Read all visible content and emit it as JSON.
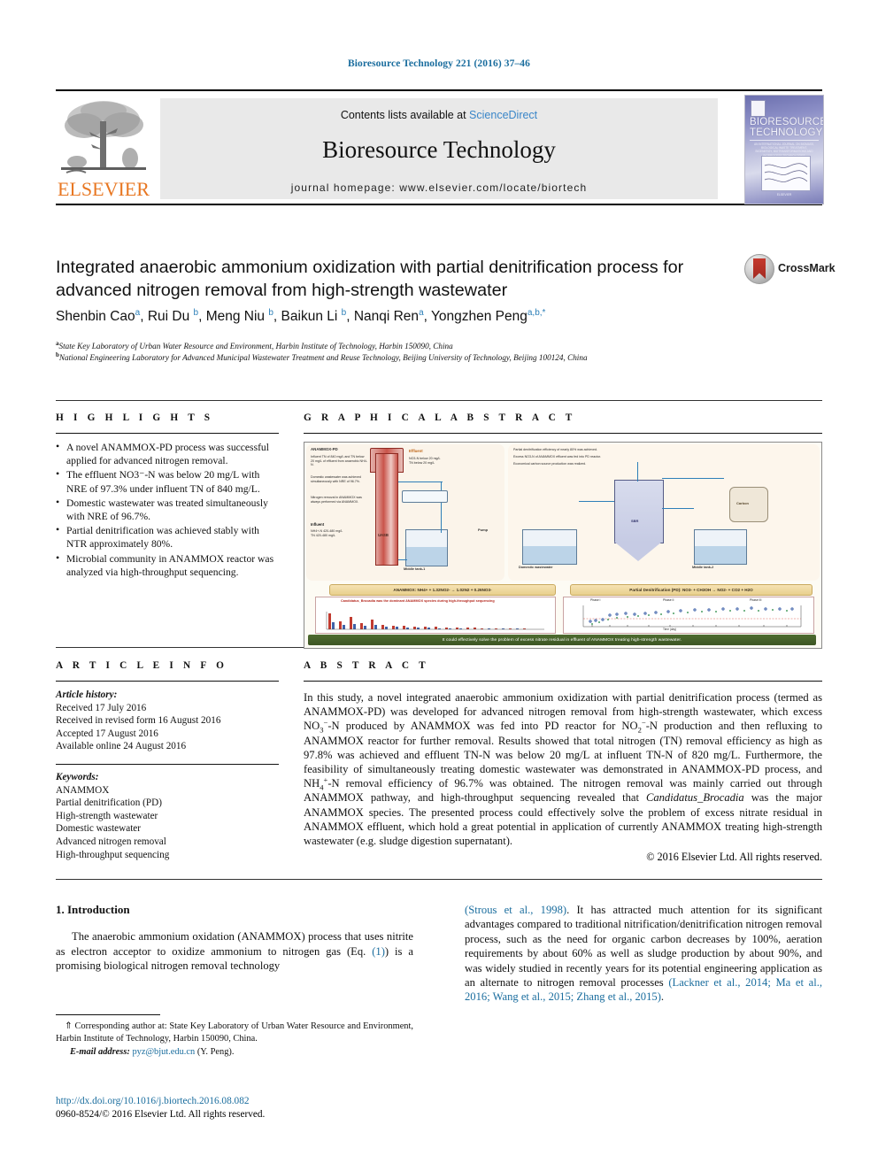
{
  "running_head": "Bioresource Technology 221 (2016) 37–46",
  "masthead": {
    "publisher_name": "ELSEVIER",
    "contents_prefix": "Contents lists available at ",
    "contents_link": "ScienceDirect",
    "journal_name": "Bioresource Technology",
    "homepage": "journal homepage: www.elsevier.com/locate/biortech",
    "cover": {
      "title_line1": "BIORESOURCE",
      "title_line2": "TECHNOLOGY",
      "subtitle": "AN INTERNATIONAL JOURNAL ON BIOMASS, BIOLOGICAL WASTE TREATMENT, BIOENERGY, BIOTRANSFORMATIONS AND BIOPROCESS TECHNOLOGIES",
      "footer": "ELSEVIER"
    }
  },
  "article": {
    "title": "Integrated anaerobic ammonium oxidization with partial denitrification process for advanced nitrogen removal from high-strength wastewater",
    "crossmark_label": "CrossMark",
    "authors": [
      {
        "name": "Shenbin Cao",
        "sup": "a"
      },
      {
        "name": "Rui Du",
        "sup": "b"
      },
      {
        "name": "Meng Niu",
        "sup": "b"
      },
      {
        "name": "Baikun Li",
        "sup": "b"
      },
      {
        "name": "Nanqi Ren",
        "sup": "a"
      },
      {
        "name": "Yongzhen Peng",
        "sup": "a,b,*"
      }
    ],
    "affiliations": [
      {
        "mark": "a",
        "text": "State Key Laboratory of Urban Water Resource and Environment, Harbin Institute of Technology, Harbin 150090, China"
      },
      {
        "mark": "b",
        "text": "National Engineering Laboratory for Advanced Municipal Wastewater Treatment and Reuse Technology, Beijing University of Technology, Beijing 100124, China"
      }
    ]
  },
  "highlights": {
    "heading": "H I G H L I G H T S",
    "items": [
      "A novel ANAMMOX-PD process was successful applied for advanced nitrogen removal.",
      "The effluent NO3⁻-N was below 20 mg/L with NRE of 97.3% under influent TN of 840 mg/L.",
      "Domestic wastewater was treated simultaneously with NRE of 96.7%.",
      "Partial denitrification was achieved stably with NTR approximately 80%.",
      "Microbial community in ANAMMOX reactor was analyzed via high-throughput sequencing."
    ]
  },
  "graphical_abstract": {
    "heading": "G R A P H I C A L   A B S T R A C T",
    "figure": {
      "left_panel_title": "ANAMMOX-PD",
      "left_panel_bullets": [
        "Influent TN of 840 mg/L and TN below 20 mg/L of effluent from anaerobic NH4-N.",
        "Domestic wastewater was achieved simultaneously with NRE of 96.7%.",
        "Nitrogen removal in ANAMMOX was always performed via ANAMMOX."
      ],
      "influent_label": "Influent",
      "influent_values": "NH4+-N 420-480 mg/L\nTN 420-480 mg/L",
      "uasb_label": "UASB",
      "effluent_label": "Effluent",
      "effluent_note": "NO3-N below 20 mg/L\nTN below 20 mg/L",
      "tank1_label": "Middle tank-1",
      "tank2_label": "Middle tank-2",
      "sbr_label": "SBR",
      "pump_label": "Pump",
      "carbon_label": "Carbon",
      "domestic_label": "Domestic wastewater",
      "right_panel_bullets": [
        "Partial denitrification efficiency of nearly 80% was achieved.",
        "Excess NO3-N of ANAMMOX effluent was fed into PD reactor.",
        "Economical carbon source production was realized."
      ],
      "anammox_equation": "ANAMMOX: NH4+ + 1.32NO2- → 1.02N2 + 0.26NO3-",
      "pd_equation": "Partial Denitrification (PD): NO3- + CH3OH → NO2- + CO2 + H2O",
      "chart_left_title": "Candidatus_Brocadia was the dominant ANAMMOX species during high-throughput sequencing",
      "chart_right_phases": [
        "Phase I",
        "Phase II",
        "Phase III"
      ],
      "chart_right_legend": [
        "TN INF",
        "TN EFF",
        "TN removal efficiency"
      ],
      "chart_right_xlabel": "Time (day)",
      "chart_right_ylabel": "TN (mg/L)",
      "chart_right_y2label": "TN removal efficiency (%)",
      "banner": "It could effectively solve the problem of excess nitrate residual in effluent of ANAMMOX treating high-strength wastewater."
    }
  },
  "article_info": {
    "heading": "A R T I C L E   I N F O",
    "history_label": "Article history:",
    "history": [
      "Received 17 July 2016",
      "Received in revised form 16 August 2016",
      "Accepted 17 August 2016",
      "Available online 24 August 2016"
    ],
    "keywords_label": "Keywords:",
    "keywords": [
      "ANAMMOX",
      "Partial denitrification (PD)",
      "High-strength wastewater",
      "Domestic wastewater",
      "Advanced nitrogen removal",
      "High-throughput sequencing"
    ]
  },
  "abstract": {
    "heading": "A B S T R A C T",
    "text_part1": "In this study, a novel integrated anaerobic ammonium oxidization with partial denitrification process (termed as ANAMMOX-PD) was developed for advanced nitrogen removal from high-strength wastewater, which excess NO",
    "text_part2": "-N produced by ANAMMOX was fed into PD reactor for NO",
    "text_part3": "-N production and then refluxing to ANAMMOX reactor for further removal. Results showed that total nitrogen (TN) removal efficiency as high as 97.8% was achieved and effluent TN-N was below 20 mg/L at influent TN-N of 820 mg/L. Furthermore, the feasibility of simultaneously treating domestic wastewater was demonstrated in ANAMMOX-PD process, and NH",
    "text_part4": "-N removal efficiency of 96.7% was obtained. The nitrogen removal was mainly carried out through ANAMMOX pathway, and high-throughput sequencing revealed that ",
    "species": "Candidatus_Brocadia",
    "text_part5": " was the major ANAMMOX species. The presented process could effectively solve the problem of excess nitrate residual in ANAMMOX effluent, which hold a great potential in application of currently ANAMMOX treating high-strength wastewater (e.g. sludge digestion supernatant).",
    "copyright": "© 2016 Elsevier Ltd. All rights reserved."
  },
  "introduction": {
    "section_number_title": "1. Introduction",
    "left_p1_a": "The anaerobic ammonium oxidation (ANAMMOX) process that uses nitrite as electron acceptor to oxidize ammonium to nitrogen gas (Eq. ",
    "left_eq_link": "(1)",
    "left_p1_b": ") is a promising biological nitrogen removal technology",
    "right_cite1": "(Strous et al., 1998)",
    "right_p1": ". It has attracted much attention for its significant advantages compared to traditional nitrification/denitrification nitrogen removal process, such as the need for organic carbon decreases by 100%, aeration requirements by about 60% as well as sludge production by about 90%, and was widely studied in recently years for its potential engineering application as an alternate to nitrogen removal processes ",
    "right_cite2": "(Lackner et al., 2014; Ma et al., 2016; Wang et al., 2015; Zhang et al., 2015)",
    "right_p1_end": "."
  },
  "footer": {
    "corresponding_marker": "⇑",
    "corresponding_text": "Corresponding author at: State Key Laboratory of Urban Water Resource and Environment, Harbin Institute of Technology, Harbin 150090, China.",
    "email_label": "E-mail address:",
    "email": "pyz@bjut.edu.cn",
    "email_owner": "(Y. Peng).",
    "doi": "http://dx.doi.org/10.1016/j.biortech.2016.08.082",
    "issn_line": "0960-8524/© 2016 Elsevier Ltd. All rights reserved."
  },
  "colors": {
    "link_blue": "#1a6d9e",
    "elsevier_orange": "#E87722",
    "sciencedirect_blue": "#3a86c8",
    "band_grey": "#e9e9e9"
  }
}
